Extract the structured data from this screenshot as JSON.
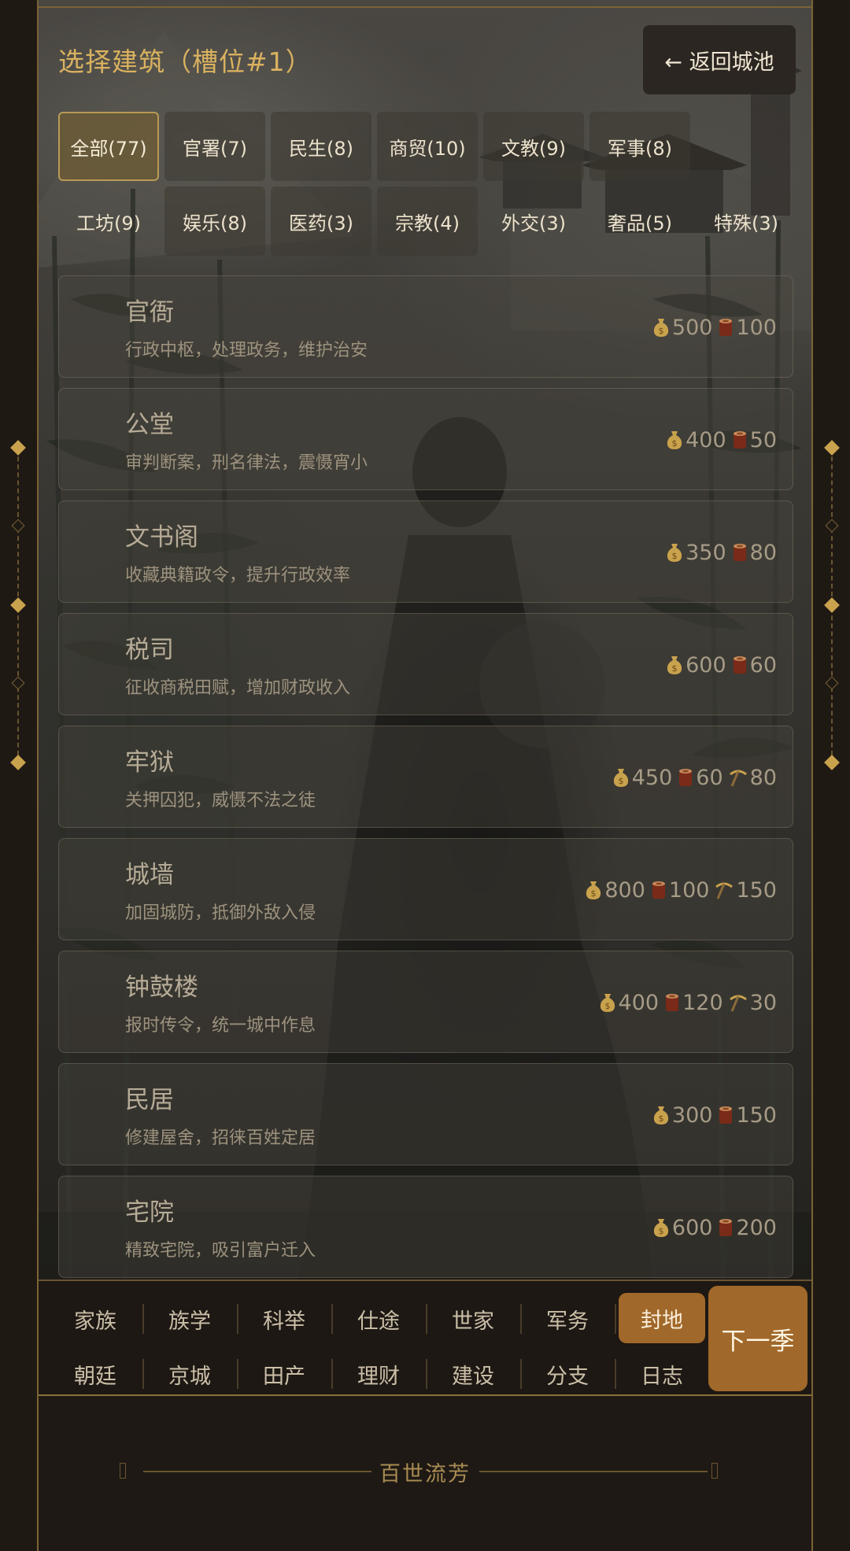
{
  "header": {
    "title": "选择建筑（槽位#1）",
    "back_label": "← 返回城池"
  },
  "categories": [
    {
      "label": "全部(77)",
      "active": true
    },
    {
      "label": "官署(7)"
    },
    {
      "label": "民生(8)"
    },
    {
      "label": "商贸(10)"
    },
    {
      "label": "文教(9)"
    },
    {
      "label": "军事(8)"
    },
    {
      "label": "工坊(9)"
    },
    {
      "label": "娱乐(8)"
    },
    {
      "label": "医药(3)"
    },
    {
      "label": "宗教(4)"
    },
    {
      "label": "外交(3)"
    },
    {
      "label": "奢品(5)"
    },
    {
      "label": "特殊(3)"
    }
  ],
  "buildings": [
    {
      "name": "官衙",
      "desc": "行政中枢，处理政务，维护治安",
      "silver": "500",
      "wood": "100",
      "ore": ""
    },
    {
      "name": "公堂",
      "desc": "审判断案，刑名律法，震慑宵小",
      "silver": "400",
      "wood": "50",
      "ore": ""
    },
    {
      "name": "文书阁",
      "desc": "收藏典籍政令，提升行政效率",
      "silver": "350",
      "wood": "80",
      "ore": ""
    },
    {
      "name": "税司",
      "desc": "征收商税田赋，增加财政收入",
      "silver": "600",
      "wood": "60",
      "ore": ""
    },
    {
      "name": "牢狱",
      "desc": "关押囚犯，威慑不法之徒",
      "silver": "450",
      "wood": "60",
      "ore": "80"
    },
    {
      "name": "城墙",
      "desc": "加固城防，抵御外敌入侵",
      "silver": "800",
      "wood": "100",
      "ore": "150"
    },
    {
      "name": "钟鼓楼",
      "desc": "报时传令，统一城中作息",
      "silver": "400",
      "wood": "120",
      "ore": "30"
    },
    {
      "name": "民居",
      "desc": "修建屋舍，招徕百姓定居",
      "silver": "300",
      "wood": "150",
      "ore": ""
    },
    {
      "name": "宅院",
      "desc": "精致宅院，吸引富户迁入",
      "silver": "600",
      "wood": "200",
      "ore": ""
    }
  ],
  "icons": {
    "silver": "money-bag-icon",
    "wood": "wood-log-icon",
    "ore": "pickaxe-icon"
  },
  "nav": {
    "row1": [
      "家族",
      "族学",
      "科举",
      "仕途",
      "世家",
      "军务",
      "封地"
    ],
    "row2": [
      "朝廷",
      "京城",
      "田产",
      "理财",
      "建设",
      "分支",
      "日志"
    ],
    "active": "封地",
    "next_label": "下一季"
  },
  "footer": {
    "brand": "百世流芳"
  },
  "colors": {
    "accent": "#d9b25f",
    "active_tab": "#a0682a",
    "border": "#7a6335"
  }
}
